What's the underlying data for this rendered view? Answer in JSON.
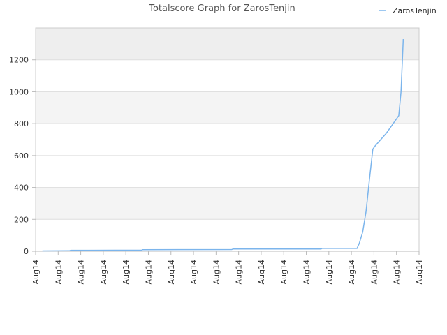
{
  "chart_data": {
    "type": "line",
    "title": "Totalscore Graph for ZarosTenjin",
    "xlabel": "",
    "ylabel": "",
    "x_tick_labels": [
      "Aug14",
      "Aug14",
      "Aug14",
      "Aug14",
      "Aug14",
      "Aug14",
      "Aug14",
      "Aug14",
      "Aug14",
      "Aug14",
      "Aug14",
      "Aug14",
      "Aug14",
      "Aug14",
      "Aug14",
      "Aug14",
      "Aug14",
      "Aug14"
    ],
    "y_ticks": [
      0,
      200,
      400,
      600,
      800,
      1000,
      1200
    ],
    "ylim": [
      0,
      1400
    ],
    "xlim": [
      0,
      17
    ],
    "grid": true,
    "legend_position": "top-right",
    "colors": {
      "series": "#7cb5ec",
      "band_a": "#eeeeee",
      "band_b": "#f4f4f4",
      "band_c": "#ffffff",
      "grid": "#dddddd"
    },
    "series": [
      {
        "name": "ZarosTenjin",
        "x": [
          0.3,
          1.5,
          1.55,
          4.7,
          4.75,
          8.7,
          8.75,
          12.65,
          12.7,
          14.25,
          14.35,
          14.5,
          14.65,
          14.8,
          14.95,
          15.05,
          15.3,
          15.55,
          15.8,
          16.1,
          16.2,
          16.3
        ],
        "values": [
          2,
          3,
          6,
          7,
          10,
          11,
          14,
          14,
          18,
          18,
          50,
          120,
          250,
          450,
          640,
          660,
          700,
          740,
          790,
          850,
          1000,
          1330
        ]
      }
    ]
  }
}
